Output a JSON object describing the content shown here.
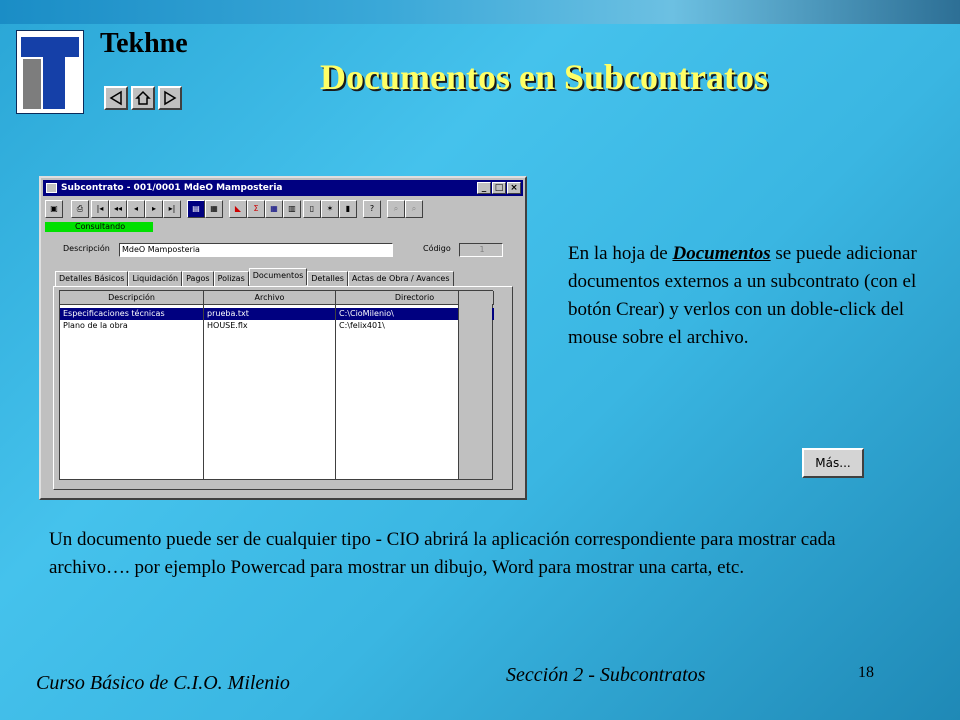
{
  "brand": "Tekhne",
  "slide_title": "Documentos en Subcontratos",
  "nav": {
    "prev_icon": "triangle-left-icon",
    "home_icon": "home-icon",
    "next_icon": "triangle-right-icon"
  },
  "window": {
    "title": "Subcontrato - 001/0001 MdeO Mamposteria",
    "min_label": "_",
    "max_label": "□",
    "close_label": "×",
    "status": "Consultando",
    "descripcion_label": "Descripción",
    "descripcion_value": "MdeO Mamposteria",
    "codigo_label": "Código",
    "codigo_value": "1",
    "tabs": [
      "Detalles Básicos",
      "Liquidación",
      "Pagos",
      "Polizas",
      "Documentos",
      "Detalles",
      "Actas de Obra / Avances"
    ],
    "active_tab": "Documentos",
    "columns": [
      "Descripción",
      "Archivo",
      "Directorio"
    ],
    "rows": [
      [
        "Especificaciones técnicas",
        "prueba.txt",
        "C:\\CioMilenio\\"
      ],
      [
        "Plano de la obra",
        "HOUSE.flx",
        "C:\\felix401\\"
      ]
    ]
  },
  "description": {
    "part1": "En la hoja de ",
    "emphasis": "Documentos",
    "part2": " se puede adicionar documentos externos a un subcontrato (con el botón Crear) y verlos con un doble-click del mouse sobre el archivo."
  },
  "mas_button": "Más...",
  "paragraph": "Un documento puede ser de cualquier tipo - CIO abrirá la aplicación correspondiente para mostrar cada archivo…. por ejemplo Powercad para mostrar un dibujo, Word para mostrar una carta, etc.",
  "footer_left": "Curso Básico de C.I.O. Milenio",
  "footer_center": "Sección 2 - Subcontratos",
  "page_number": "18",
  "colors": {
    "title": "#ffff66",
    "titlebar": "#000080",
    "selection": "#000080",
    "status": "#00e000"
  }
}
